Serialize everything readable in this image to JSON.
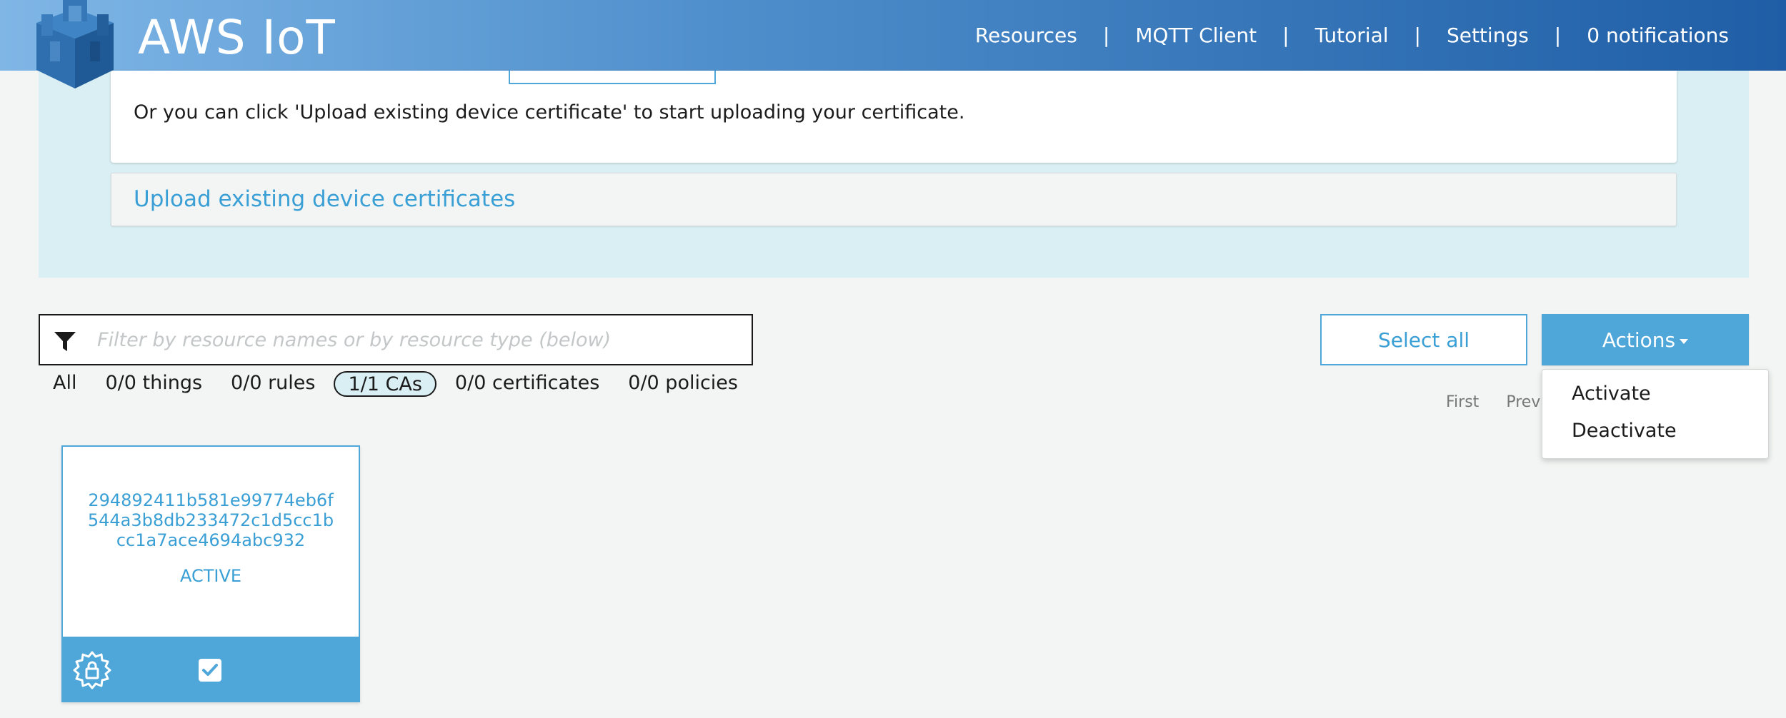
{
  "app": {
    "title": "AWS IoT"
  },
  "nav": {
    "items": [
      "Resources",
      "MQTT Client",
      "Tutorial",
      "Settings",
      "0 notifications"
    ],
    "separator": "|"
  },
  "info": {
    "text": "Or you can click 'Upload existing device certificate' to start uploading your certificate."
  },
  "upload": {
    "label": "Upload existing device certificates"
  },
  "filter": {
    "placeholder": "Filter by resource names or by resource type (below)",
    "value": ""
  },
  "type_tabs": [
    {
      "label": "All",
      "active": false
    },
    {
      "label": "0/0 things",
      "active": false
    },
    {
      "label": "0/0 rules",
      "active": false
    },
    {
      "label": "1/1 CAs",
      "active": true
    },
    {
      "label": "0/0 certificates",
      "active": false
    },
    {
      "label": "0/0 policies",
      "active": false
    }
  ],
  "buttons": {
    "select_all": "Select all",
    "actions": "Actions"
  },
  "pager": {
    "first": "First",
    "prev": "Prev"
  },
  "actions_menu": {
    "items": [
      "Activate",
      "Deactivate"
    ]
  },
  "card": {
    "id_lines": [
      "294892411b581e99774eb6f",
      "544a3b8db233472c1d5cc1b",
      "cc1a7ace4694abc932"
    ],
    "status": "ACTIVE",
    "icons": [
      "certificate-badge-icon",
      "checkbox-checked-icon"
    ]
  },
  "colors": {
    "accent": "#4ea6d9",
    "link": "#3a9fd5",
    "panel": "#d9eff3",
    "header_start": "#7fb6e6",
    "header_end": "#1f5ea6"
  }
}
